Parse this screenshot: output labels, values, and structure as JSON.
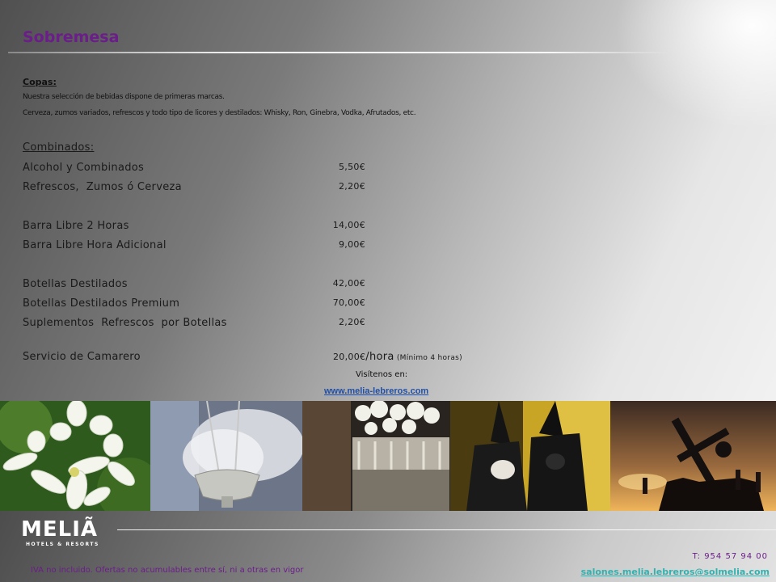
{
  "title": "Sobremesa",
  "copas": {
    "heading": "Copas:",
    "line1": "Nuestra selección de bebidas dispone de primeras marcas.",
    "line2": "Cerveza, zumos variados, refrescos y todo tipo de licores y destilados: Whisky, Ron, Ginebra, Vodka, Afrutados, etc."
  },
  "combinados": {
    "heading": "Combinados:",
    "items": [
      {
        "label": "Alcohol y Combinados",
        "price": "5,50€"
      },
      {
        "label": "Refrescos,  Zumos ó Cerveza",
        "price": "2,20€"
      },
      {
        "label": "Barra Libre 2 Horas",
        "price": "14,00€"
      },
      {
        "label": "Barra Libre Hora Adicional",
        "price": "9,00€"
      },
      {
        "label": "Botellas Destilados",
        "price": "42,00€"
      },
      {
        "label": "Botellas Destilados Premium",
        "price": "70,00€"
      },
      {
        "label": "Suplementos  Refrescos  por Botellas",
        "price": "2,20€"
      }
    ],
    "service": {
      "label": "Servicio de Camarero",
      "price": "20,00€",
      "unit": "/hora",
      "note": " (Mínimo 4 horas)"
    }
  },
  "visit_label": "Visítenos en:",
  "website": "www.melia-lebreros.com",
  "photos": [
    "orange-blossom-photo",
    "incense-censer-photo",
    "procession-float-photo",
    "nazarenos-photo",
    "cross-silhouette-photo"
  ],
  "logo": {
    "word": "MELIÃ",
    "tagline": "HOTELS & RESORTS"
  },
  "footer": {
    "phone": "T: 954 57 94 00",
    "email": "salones.melia.lebreros@solmelia.com",
    "iva_note": "IVA no incluido. Ofertas no acumulables entre sí, ni a otras en vigor"
  },
  "colors": {
    "title": "#6b1d8a",
    "link": "#1f4fa8",
    "email": "#2fb3b0"
  }
}
